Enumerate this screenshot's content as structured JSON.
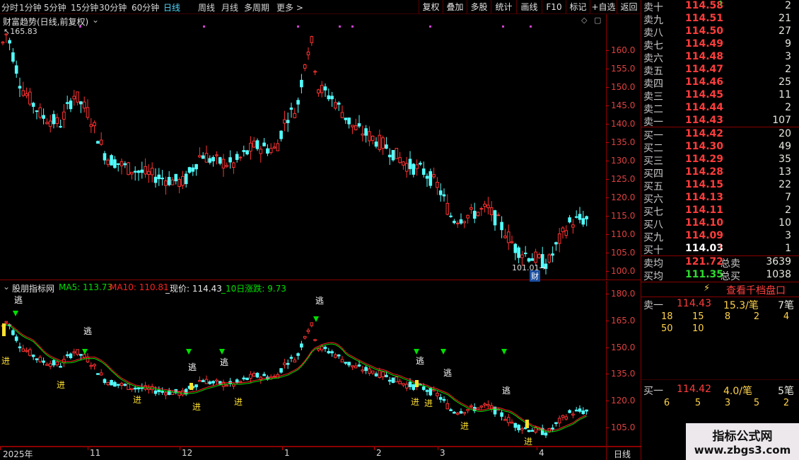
{
  "toolbar": {
    "periods": [
      "分时",
      "1分钟",
      "5分钟",
      "15分钟",
      "30分钟",
      "60分钟",
      "日线",
      "周线",
      "月线",
      "多周期",
      "更多 >"
    ],
    "active_period": "日线",
    "buttons": [
      "复权",
      "叠加",
      "多股",
      "统计",
      "画线",
      "F10",
      "标记",
      "+自选",
      "返回"
    ]
  },
  "main_chart": {
    "title": "财富趋势(日线,前复权)",
    "high_label": "165.83",
    "low_label": "101.01",
    "cai_marker": "财",
    "yticks": [
      "160.0",
      "155.0",
      "150.0",
      "145.0",
      "140.0",
      "135.0",
      "130.0",
      "125.0",
      "120.0",
      "115.0",
      "110.0",
      "105.0",
      "100.0"
    ]
  },
  "indicator": {
    "name": "股朋指标网",
    "ma5_label": "MA5: 113.73",
    "ma10_label": "MA10: 110.81",
    "price_label": "_现价: 114.43",
    "change_label": "_10日涨跌: 9.73",
    "yticks": [
      "180.0",
      "165.0",
      "150.0",
      "135.0",
      "120.0",
      "105.0"
    ],
    "escape_text": "逃",
    "enter_text": "进",
    "colors": {
      "ma5": "#00e000",
      "ma10": "#ff2020",
      "price": "#e8e8e8",
      "change": "#00e000"
    }
  },
  "xaxis": {
    "labels": [
      "2025年",
      "11",
      "12",
      "1",
      "2",
      "3",
      "4"
    ],
    "period_label": "日线"
  },
  "quote": {
    "sells": [
      {
        "label": "卖十",
        "price": "114.58",
        "vol": "2",
        "arrow": "↑"
      },
      {
        "label": "卖九",
        "price": "114.51",
        "vol": "21"
      },
      {
        "label": "卖八",
        "price": "114.50",
        "vol": "27"
      },
      {
        "label": "卖七",
        "price": "114.49",
        "vol": "9"
      },
      {
        "label": "卖六",
        "price": "114.48",
        "vol": "3"
      },
      {
        "label": "卖五",
        "price": "114.47",
        "vol": "2"
      },
      {
        "label": "卖四",
        "price": "114.46",
        "vol": "25"
      },
      {
        "label": "卖三",
        "price": "114.45",
        "vol": "11"
      },
      {
        "label": "卖二",
        "price": "114.44",
        "vol": "2"
      },
      {
        "label": "卖一",
        "price": "114.43",
        "vol": "107"
      }
    ],
    "buys": [
      {
        "label": "买一",
        "price": "114.42",
        "vol": "20"
      },
      {
        "label": "买二",
        "price": "114.30",
        "vol": "49"
      },
      {
        "label": "买三",
        "price": "114.29",
        "vol": "35"
      },
      {
        "label": "买四",
        "price": "114.28",
        "vol": "13"
      },
      {
        "label": "买五",
        "price": "114.15",
        "vol": "22"
      },
      {
        "label": "买六",
        "price": "114.13",
        "vol": "7"
      },
      {
        "label": "买七",
        "price": "114.11",
        "vol": "2"
      },
      {
        "label": "买八",
        "price": "114.10",
        "vol": "10"
      },
      {
        "label": "买九",
        "price": "114.09",
        "vol": "3"
      },
      {
        "label": "买十",
        "price": "114.03",
        "vol": "1",
        "arrow": "↓"
      }
    ],
    "avg_sell_label": "卖均",
    "avg_sell_price": "121.72",
    "total_sell_label": "总卖",
    "total_sell": "3639",
    "avg_buy_label": "买均",
    "avg_buy_price": "111.35",
    "total_buy_label": "总买",
    "total_buy": "1038",
    "thousand_button": "查看千档盘口",
    "sell1_label": "卖一",
    "sell1_price": "114.43",
    "sell1_avg": "15.3/笔",
    "sell1_count": "7笔",
    "sell1_queue": [
      [
        "18",
        "15",
        "8",
        "2",
        "4"
      ],
      [
        "50",
        "10"
      ]
    ],
    "buy1_label": "买一",
    "buy1_price": "114.42",
    "buy1_avg": "4.0/笔",
    "buy1_count": "5笔",
    "buy1_queue": [
      [
        "6",
        "5",
        "3",
        "5",
        "2"
      ]
    ]
  },
  "watermark": {
    "line1": "指标公式网",
    "line2": "www.zbgs3.com"
  },
  "colors": {
    "up": "#ff3232",
    "down": "#54ffff",
    "sell_price": "#ff3c3c",
    "buy_price": "#ff3c3c",
    "accent": "#ffd24a"
  }
}
